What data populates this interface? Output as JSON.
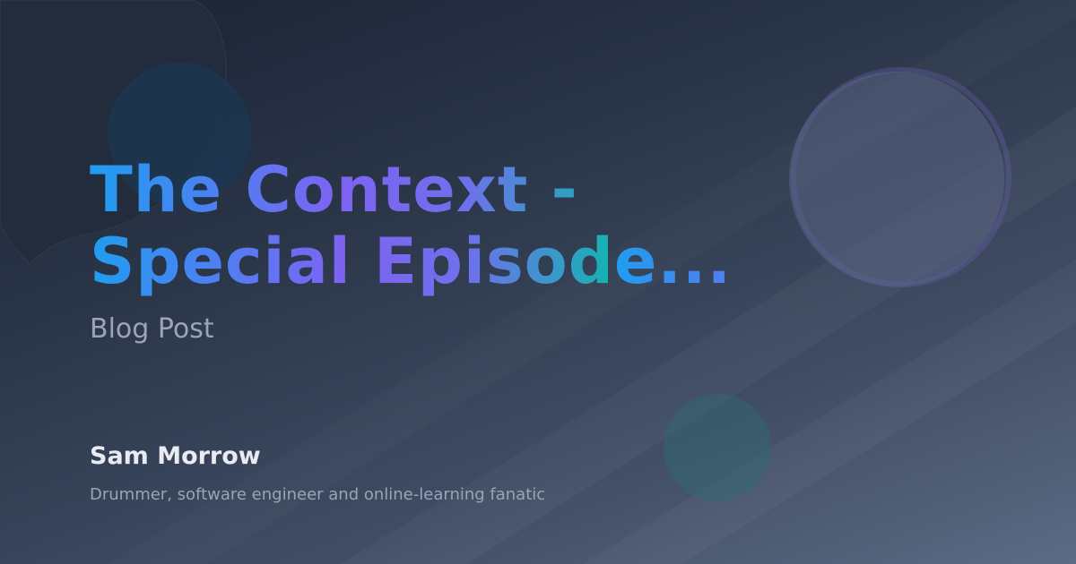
{
  "post": {
    "title_line1": "The Context -",
    "title_line2": "Special Episode...",
    "category": "Blog Post"
  },
  "author": {
    "name": "Sam Morrow",
    "bio": "Drummer, software engineer and online-learning fanatic"
  },
  "colors": {
    "background_start": "#1a2233",
    "background_end": "#5c6a84",
    "title_gradient": [
      "#1f9df0",
      "#7e63f2",
      "#16b3b3"
    ],
    "subtitle": "#9aa4b5",
    "author_name": "#e8ecf2"
  }
}
